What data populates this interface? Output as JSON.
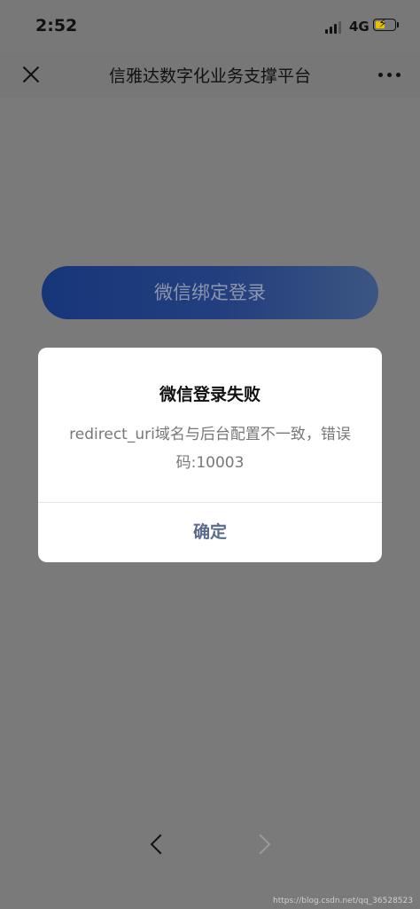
{
  "status_bar": {
    "time": "2:52",
    "network": "4G",
    "battery_level": 0.6,
    "battery_color": "#e6c200"
  },
  "navbar": {
    "close_icon": "close-icon",
    "title": "信雅达数字化业务支撑平台",
    "more_icon": "more-icon"
  },
  "main": {
    "bind_button_label": "微信绑定登录"
  },
  "dialog": {
    "title": "微信登录失败",
    "message": "redirect_uri域名与后台配置不一致，错误码:10003",
    "confirm_label": "确定"
  },
  "bottom_nav": {
    "back_icon": "chevron-left-icon",
    "forward_icon": "chevron-right-icon"
  },
  "watermark": "https://blog.csdn.net/qq_36528523"
}
